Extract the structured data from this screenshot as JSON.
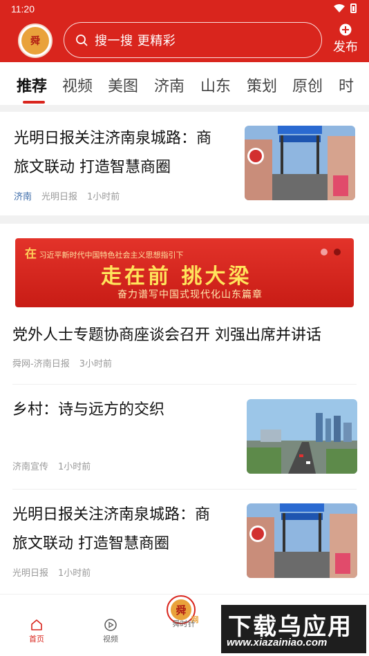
{
  "status_bar": {
    "time": "11:20",
    "icons": [
      "wifi-icon",
      "battery-icon"
    ]
  },
  "header": {
    "logo_icon": "app-logo-icon",
    "search": {
      "placeholder": "搜一搜 更精彩",
      "icon": "search-icon"
    },
    "publish": {
      "label": "发布",
      "icon": "plus-circle-icon"
    }
  },
  "tabs": [
    {
      "label": "推荐",
      "active": true
    },
    {
      "label": "视频"
    },
    {
      "label": "美图"
    },
    {
      "label": "济南"
    },
    {
      "label": "山东"
    },
    {
      "label": "策划"
    },
    {
      "label": "原创"
    },
    {
      "label": "时"
    }
  ],
  "feed": [
    {
      "title_line1": "光明日报关注济南泉城路：商",
      "title_line2": "旅文联动 打造智慧商圈",
      "tag": "济南",
      "source": "光明日报",
      "time": "1小时前"
    },
    {
      "banner_line": "习近平新时代中国特色社会主义思想指引下",
      "banner_seal": "在",
      "banner_big": "走在前 挑大梁",
      "banner_sub": "奋力谱写中国式现代化山东篇章",
      "title": "党外人士专题协商座谈会召开 刘强出席并讲话",
      "source": "舜网-济南日报",
      "time": "3小时前"
    },
    {
      "title": "乡村：诗与远方的交织",
      "source": "济南宣传",
      "time": "1小时前"
    },
    {
      "title_line1": "光明日报关注济南泉城路：商",
      "title_line2": "旅文联动 打造智慧商圈",
      "source": "光明日报",
      "time": "1小时前"
    }
  ],
  "bottom_nav": [
    {
      "label": "首页",
      "icon": "home-icon",
      "active": true
    },
    {
      "label": "视频",
      "icon": "play-circle-icon"
    },
    {
      "label": "舜时针",
      "icon": "shun-logo-icon"
    }
  ],
  "watermark": {
    "line1": "下载乌应用",
    "line2": "www.xiazainiao.com"
  },
  "colors": {
    "brand_red": "#d9251d",
    "tag_blue": "#3a6aa8",
    "meta_gray": "#999999"
  }
}
